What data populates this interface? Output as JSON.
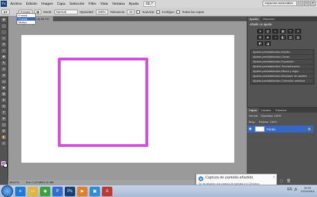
{
  "menubar": {
    "logo": "Ps",
    "items": [
      "Archivo",
      "Edición",
      "Imagen",
      "Capa",
      "Selección",
      "Filtro",
      "Vista",
      "Ventana",
      "Ayuda"
    ],
    "zoom": "66,7",
    "workspace": "Aspectos esenciales"
  },
  "options": {
    "mode_label": "Modo:",
    "mode_value": "Normal",
    "opacity_label": "Opacidad:",
    "opacity_value": "100%",
    "tolerance_label": "Tolerancia:",
    "tolerance_value": "32",
    "antialias_label": "Suavizar",
    "contiguous_label": "Contiguo",
    "all_layers_label": "Todas las capas"
  },
  "fill_dropdown": {
    "options": [
      "Frontal",
      "Frontal",
      "Motivo"
    ],
    "selected_index": 1
  },
  "document": {
    "tab_label": "Sin título-1 @ 66,7% (RGB/8) *",
    "stroke_color": "#d94ae0"
  },
  "status": {
    "zoom": "66,67%",
    "doc_info": "Doc: 2,29 MB/2,31 MB"
  },
  "adjustments": {
    "tabs": [
      "Ajustes",
      "Máscaras"
    ],
    "title": "Añadir un ajuste",
    "icons": [
      "☀",
      "▥",
      "◐",
      "▦",
      "▽",
      "⚖",
      "⊞",
      "■",
      "◑",
      "◧",
      "▤",
      "▧",
      "◩",
      "◪"
    ],
    "presets": [
      "Ajustes preestablecidos Niveles",
      "Ajustes preestablecidos Curvas",
      "Ajustes preestablecidos Exposición",
      "Ajustes preestablecidos Tono/saturación",
      "Ajustes preestablecidos Blanco y negro",
      "Ajustes preestablecidos Mezclador de canales",
      "Ajustes preestablecidos Corrección selectiva"
    ]
  },
  "layers": {
    "tabs": [
      "Capas",
      "Canales",
      "Trazados"
    ],
    "blend": "Normal",
    "opacity": "Opacidad: 100%",
    "lock": "Bloq.:",
    "fill": "Relleno: 100%",
    "layer_name": "Fondo",
    "bottom_icons": [
      "⛓",
      "fx",
      "◐",
      "◑",
      "▭",
      "▢",
      "🗑"
    ]
  },
  "toast": {
    "title": "Captura de pantalla añadida",
    "body": "Se ha añadido una captura de pantalla a tu Dropbox."
  },
  "taskbar": {
    "apps": [
      {
        "label": "e",
        "color": "#1f7bd8"
      },
      {
        "label": "▭",
        "color": "#e6b33c"
      },
      {
        "label": "◉",
        "color": "#3aa23a"
      },
      {
        "label": "P",
        "color": "#2e6fd6"
      },
      {
        "label": "Ps",
        "color": "#1a3f73"
      },
      {
        "label": "▶",
        "color": "#e67e22"
      },
      {
        "label": "▣",
        "color": "#2c8fd6"
      },
      {
        "label": "A",
        "color": "#c0392b"
      }
    ],
    "time": "10:43",
    "date": "17/01/2014"
  }
}
